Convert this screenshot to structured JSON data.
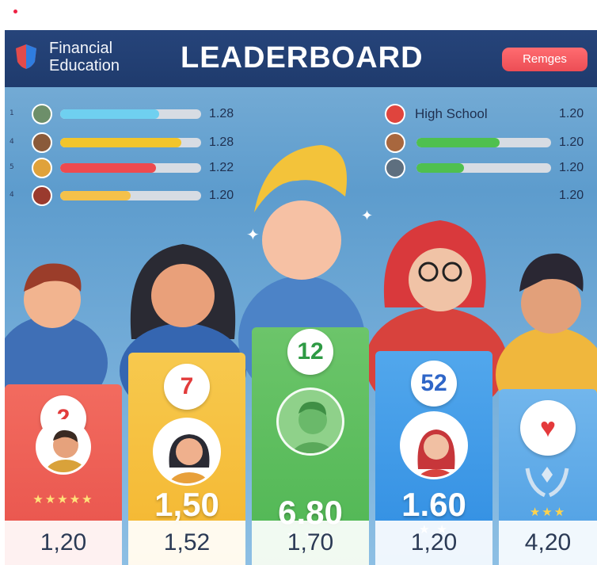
{
  "header": {
    "brand": "Financial Education",
    "title": "LEADERBOARD",
    "button_label": "Remges"
  },
  "left_rows": [
    {
      "index": "1",
      "bar_fill": 0.7,
      "bar_color": "#6fd0f0",
      "score": "1.28"
    },
    {
      "index": "4",
      "bar_fill": 0.86,
      "bar_color": "#f2c52c",
      "score": "1.28"
    },
    {
      "index": "5",
      "bar_fill": 0.68,
      "bar_color": "#ee4a4f",
      "score": "1.22"
    },
    {
      "index": "4",
      "bar_fill": 0.5,
      "bar_color": "#f5c14a",
      "score": "1.20"
    }
  ],
  "right_group": {
    "label": "High School",
    "rows": [
      {
        "bar_fill": 0.0,
        "bar_color": "#4fc04f",
        "score": "1.20"
      },
      {
        "bar_fill": 0.62,
        "bar_color": "#4fc04f",
        "score": "1.20"
      },
      {
        "bar_fill": 0.35,
        "bar_color": "#4fc04f",
        "score": "1.20"
      }
    ],
    "extra_score": "1.20"
  },
  "cards": [
    {
      "badge": "2",
      "badge_color": "#e23b3b",
      "bg": "#e8524b",
      "bg2": "#f26b5f",
      "points": "",
      "stars": "★★★★★",
      "footer": "1,20"
    },
    {
      "badge": "7",
      "badge_color": "#e23b3b",
      "bg": "#f4b62f",
      "bg2": "#f7c94e",
      "points": "1,50",
      "stars": "",
      "footer": "1,52"
    },
    {
      "badge": "12",
      "badge_color": "#2e9a44",
      "bg": "#4fb653",
      "bg2": "#6cc56a",
      "points": "6.80",
      "stars": "★ ★ ★",
      "footer": "1,70"
    },
    {
      "badge": "52",
      "badge_color": "#2f66c8",
      "bg": "#2f8de2",
      "bg2": "#52a7ec",
      "points": "1.60",
      "stars": "★ ★",
      "footer": "1,20"
    },
    {
      "badge": "♥",
      "badge_color": "#e4393b",
      "bg": "#4c9ee3",
      "bg2": "#72b6ec",
      "points": "",
      "stars": "★★★",
      "footer": "4,20"
    }
  ]
}
